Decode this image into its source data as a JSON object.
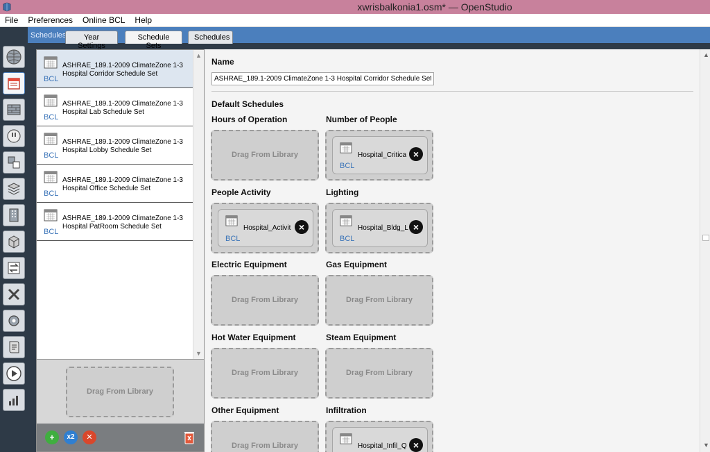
{
  "window": {
    "title": "xwrisbalkonia1.osm* — OpenStudio"
  },
  "menu": [
    "File",
    "Preferences",
    "Online BCL",
    "Help"
  ],
  "tabs": {
    "section_label": "Schedules",
    "items": [
      "Year Settings",
      "Schedule Sets",
      "Schedules"
    ],
    "active": "Schedule Sets"
  },
  "left_icons": [
    "site-icon",
    "schedules-icon",
    "constructions-icon",
    "loads-icon",
    "space-types-icon",
    "geometry-icon",
    "facility-icon",
    "spaces-icon",
    "thermal-zones-icon",
    "hvac-icon",
    "output-variables-icon",
    "simulation-settings-icon",
    "run-icon",
    "results-icon"
  ],
  "schedule_sets": [
    {
      "line1": "ASHRAE_189.1-2009 ClimateZone 1-3",
      "line2": "Hospital Corridor Schedule Set",
      "badge": "BCL",
      "selected": true
    },
    {
      "line1": "ASHRAE_189.1-2009 ClimateZone 1-3",
      "line2": "Hospital Lab Schedule Set",
      "badge": "BCL"
    },
    {
      "line1": "ASHRAE_189.1-2009 ClimateZone 1-3",
      "line2": "Hospital Lobby Schedule Set",
      "badge": "BCL"
    },
    {
      "line1": "ASHRAE_189.1-2009 ClimateZone 1-3",
      "line2": "Hospital Office Schedule Set",
      "badge": "BCL"
    },
    {
      "line1": "ASHRAE_189.1-2009 ClimateZone 1-3",
      "line2": "Hospital PatRoom Schedule Set",
      "badge": "BCL"
    }
  ],
  "left_drop": {
    "text": "Drag From Library"
  },
  "toolbar": {
    "add": "+",
    "copy": "x2",
    "remove": "✕"
  },
  "detail": {
    "name_label": "Name",
    "name_value": "ASHRAE_189.1-2009 ClimateZone 1-3 Hospital Corridor Schedule Set",
    "section": "Default Schedules",
    "drop_text": "Drag From Library",
    "badge": "BCL",
    "slots": {
      "hours_of_operation": {
        "label": "Hours of Operation"
      },
      "number_of_people": {
        "label": "Number of People",
        "value": "Hospital_Critica"
      },
      "people_activity": {
        "label": "People Activity",
        "value": "Hospital_Activit"
      },
      "lighting": {
        "label": "Lighting",
        "value": "Hospital_Bldg_L"
      },
      "electric_equipment": {
        "label": "Electric Equipment"
      },
      "gas_equipment": {
        "label": "Gas Equipment"
      },
      "hot_water_equipment": {
        "label": "Hot Water Equipment"
      },
      "steam_equipment": {
        "label": "Steam Equipment"
      },
      "other_equipment": {
        "label": "Other Equipment"
      },
      "infiltration": {
        "label": "Infiltration",
        "value": "Hospital_Infil_Q"
      }
    }
  },
  "colors": {
    "accent": "#4b7fbd",
    "titlebar": "#c8819c",
    "bcl": "#3b74b8"
  }
}
